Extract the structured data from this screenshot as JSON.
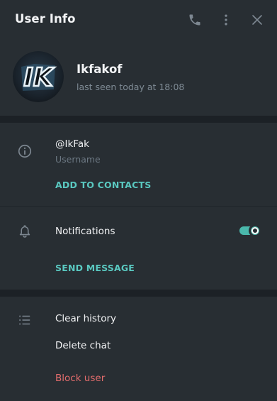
{
  "header": {
    "title": "User Info",
    "icons": [
      "phone-icon",
      "more-vertical-icon",
      "close-icon"
    ]
  },
  "profile": {
    "name": "Ikfakof",
    "status": "last seen today at 18:08",
    "avatar_text": "IK"
  },
  "info": {
    "username": "@IkFak",
    "username_label": "Username",
    "add_to_contacts": "ADD TO CONTACTS"
  },
  "notifications": {
    "label": "Notifications",
    "enabled": true,
    "send_message": "SEND MESSAGE"
  },
  "actions": {
    "clear_history": "Clear history",
    "delete_chat": "Delete chat",
    "block_user": "Block user"
  },
  "colors": {
    "background": "#282e33",
    "accent": "#5ac9c1",
    "danger": "#e36d6d",
    "muted": "#6c7883"
  }
}
